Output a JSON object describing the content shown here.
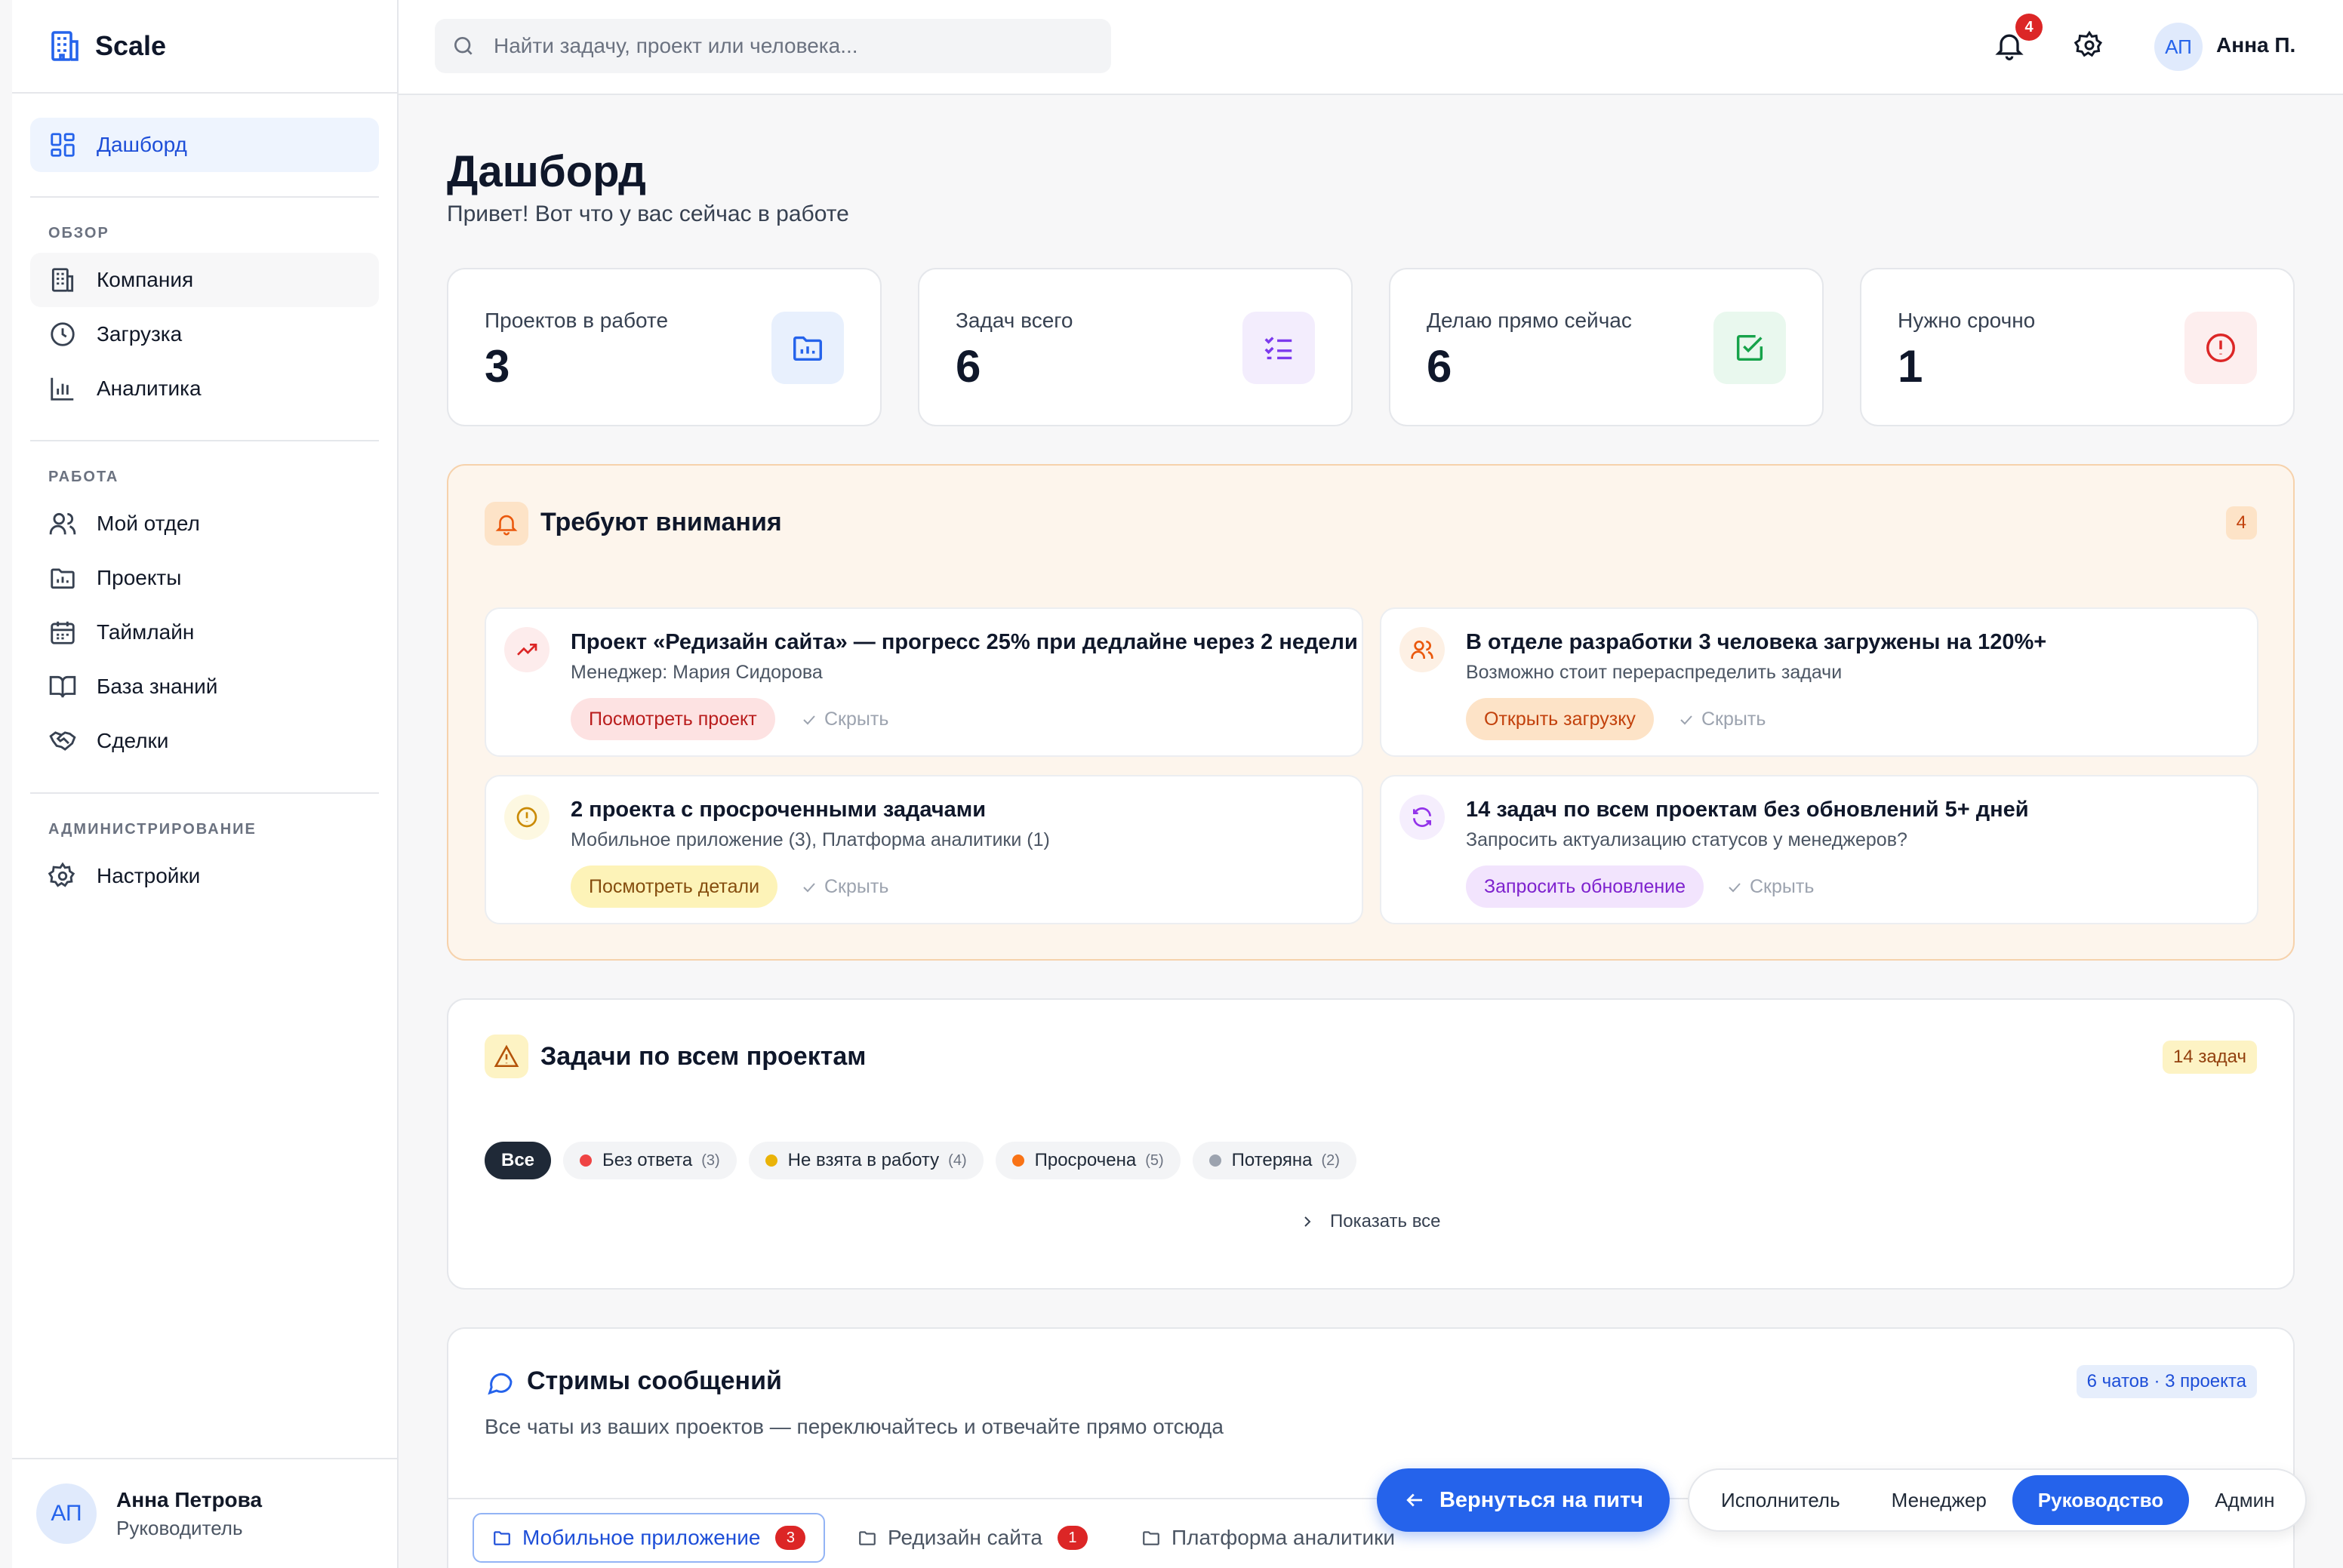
{
  "app": {
    "name": "Scale"
  },
  "sidebar": {
    "dashboard": "Дашборд",
    "sections": [
      {
        "label": "ОБЗОР",
        "items": [
          "Компания",
          "Загрузка",
          "Аналитика"
        ]
      },
      {
        "label": "РАБОТА",
        "items": [
          "Мой отдел",
          "Проекты",
          "Таймлайн",
          "База знаний",
          "Сделки"
        ]
      },
      {
        "label": "АДМИНИСТРИРОВАНИЕ",
        "items": [
          "Настройки"
        ]
      }
    ],
    "user": {
      "initials": "АП",
      "name": "Анна Петрова",
      "role": "Руководитель"
    }
  },
  "topbar": {
    "search_placeholder": "Найти задачу, проект или человека...",
    "notifications": "4",
    "user_initials": "АП",
    "user_name": "Анна П."
  },
  "page": {
    "title": "Дашборд",
    "subtitle": "Привет! Вот что у вас сейчас в работе"
  },
  "stats": [
    {
      "label": "Проектов в работе",
      "value": "3",
      "icon": "folder-chart-icon",
      "color": "#2563eb"
    },
    {
      "label": "Задач всего",
      "value": "6",
      "icon": "list-check-icon",
      "color": "#7c3aed"
    },
    {
      "label": "Делаю прямо сейчас",
      "value": "6",
      "icon": "check-square-icon",
      "color": "#16a34a"
    },
    {
      "label": "Нужно срочно",
      "value": "1",
      "icon": "alert-circle-icon",
      "color": "#dc2626"
    }
  ],
  "attention": {
    "title": "Требуют внимания",
    "count": "4",
    "items": [
      {
        "title": "Проект «Редизайн сайта» — прогресс 25% при дедлайне через 2 недели",
        "desc": "Менеджер: Мария Сидорова",
        "action": "Посмотреть проект",
        "hide": "Скрыть",
        "icon": "trending-up-icon"
      },
      {
        "title": "В отделе разработки 3 человека загружены на 120%+",
        "desc": "Возможно стоит перераспределить задачи",
        "action": "Открыть загрузку",
        "hide": "Скрыть",
        "icon": "users-icon"
      },
      {
        "title": "2 проекта с просроченными задачами",
        "desc": "Мобильное приложение (3), Платформа аналитики (1)",
        "action": "Посмотреть детали",
        "hide": "Скрыть",
        "icon": "alert-circle-icon"
      },
      {
        "title": "14 задач по всем проектам без обновлений 5+ дней",
        "desc": "Запросить актуализацию статусов у менеджеров?",
        "action": "Запросить обновление",
        "hide": "Скрыть",
        "icon": "refresh-icon"
      }
    ]
  },
  "tasks": {
    "title": "Задачи по всем проектам",
    "count": "14 задач",
    "filters": [
      {
        "label": "Все",
        "count": ""
      },
      {
        "label": "Без ответа",
        "count": "(3)",
        "color": "#ef4444"
      },
      {
        "label": "Не взята в работу",
        "count": "(4)",
        "color": "#eab308"
      },
      {
        "label": "Просрочена",
        "count": "(5)",
        "color": "#f97316"
      },
      {
        "label": "Потеряна",
        "count": "(2)",
        "color": "#9ca3af"
      }
    ],
    "show_all": "Показать все"
  },
  "streams": {
    "title": "Стримы сообщений",
    "count": "6 чатов · 3 проекта",
    "desc": "Все чаты из ваших проектов — переключайтесь и отвечайте прямо отсюда",
    "tabs": [
      {
        "label": "Мобильное приложение",
        "count": "3"
      },
      {
        "label": "Редизайн сайта",
        "count": "1"
      },
      {
        "label": "Платформа аналитики",
        "count": ""
      }
    ]
  },
  "footer": {
    "back": "Вернуться на питч",
    "roles": [
      "Исполнитель",
      "Менеджер",
      "Руководство",
      "Админ"
    ]
  }
}
